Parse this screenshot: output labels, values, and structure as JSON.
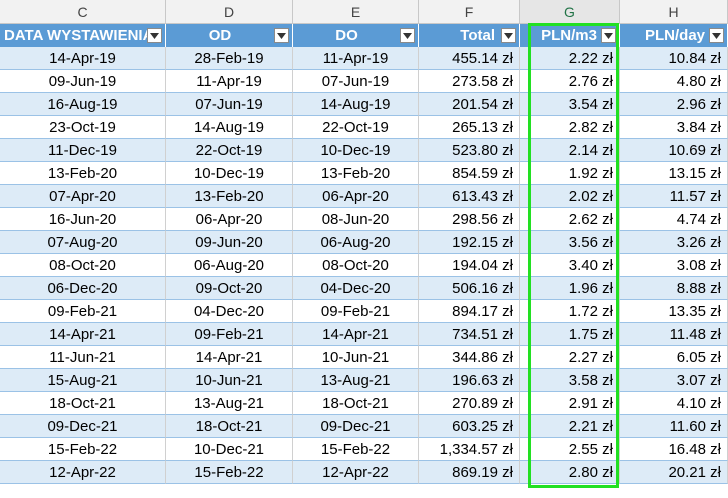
{
  "column_letters": [
    "C",
    "D",
    "E",
    "F",
    "G",
    "H"
  ],
  "selected_column": "G",
  "headers": [
    "DATA WYSTAWIENIA",
    "OD",
    "DO",
    "Total",
    "PLN/m3",
    "PLN/day"
  ],
  "header_fill": "#5b9bd5",
  "band_fill": "#ddebf7",
  "highlight_color": "#22e022",
  "filter_icon": "chevron-down-icon",
  "rows": [
    [
      "14-Apr-19",
      "28-Feb-19",
      "11-Apr-19",
      "455.14 zł",
      "2.22 zł",
      "10.84 zł"
    ],
    [
      "09-Jun-19",
      "11-Apr-19",
      "07-Jun-19",
      "273.58 zł",
      "2.76 zł",
      "4.80 zł"
    ],
    [
      "16-Aug-19",
      "07-Jun-19",
      "14-Aug-19",
      "201.54 zł",
      "3.54 zł",
      "2.96 zł"
    ],
    [
      "23-Oct-19",
      "14-Aug-19",
      "22-Oct-19",
      "265.13 zł",
      "2.82 zł",
      "3.84 zł"
    ],
    [
      "11-Dec-19",
      "22-Oct-19",
      "10-Dec-19",
      "523.80 zł",
      "2.14 zł",
      "10.69 zł"
    ],
    [
      "13-Feb-20",
      "10-Dec-19",
      "13-Feb-20",
      "854.59 zł",
      "1.92 zł",
      "13.15 zł"
    ],
    [
      "07-Apr-20",
      "13-Feb-20",
      "06-Apr-20",
      "613.43 zł",
      "2.02 zł",
      "11.57 zł"
    ],
    [
      "16-Jun-20",
      "06-Apr-20",
      "08-Jun-20",
      "298.56 zł",
      "2.62 zł",
      "4.74 zł"
    ],
    [
      "07-Aug-20",
      "09-Jun-20",
      "06-Aug-20",
      "192.15 zł",
      "3.56 zł",
      "3.26 zł"
    ],
    [
      "08-Oct-20",
      "06-Aug-20",
      "08-Oct-20",
      "194.04 zł",
      "3.40 zł",
      "3.08 zł"
    ],
    [
      "06-Dec-20",
      "09-Oct-20",
      "04-Dec-20",
      "506.16 zł",
      "1.96 zł",
      "8.88 zł"
    ],
    [
      "09-Feb-21",
      "04-Dec-20",
      "09-Feb-21",
      "894.17 zł",
      "1.72 zł",
      "13.35 zł"
    ],
    [
      "14-Apr-21",
      "09-Feb-21",
      "14-Apr-21",
      "734.51 zł",
      "1.75 zł",
      "11.48 zł"
    ],
    [
      "11-Jun-21",
      "14-Apr-21",
      "10-Jun-21",
      "344.86 zł",
      "2.27 zł",
      "6.05 zł"
    ],
    [
      "15-Aug-21",
      "10-Jun-21",
      "13-Aug-21",
      "196.63 zł",
      "3.58 zł",
      "3.07 zł"
    ],
    [
      "18-Oct-21",
      "13-Aug-21",
      "18-Oct-21",
      "270.89 zł",
      "2.91 zł",
      "4.10 zł"
    ],
    [
      "09-Dec-21",
      "18-Oct-21",
      "09-Dec-21",
      "603.25 zł",
      "2.21 zł",
      "11.60 zł"
    ],
    [
      "15-Feb-22",
      "10-Dec-21",
      "15-Feb-22",
      "1,334.57 zł",
      "2.55 zł",
      "16.48 zł"
    ],
    [
      "12-Apr-22",
      "15-Feb-22",
      "12-Apr-22",
      "869.19 zł",
      "2.80 zł",
      "20.21 zł"
    ]
  ]
}
